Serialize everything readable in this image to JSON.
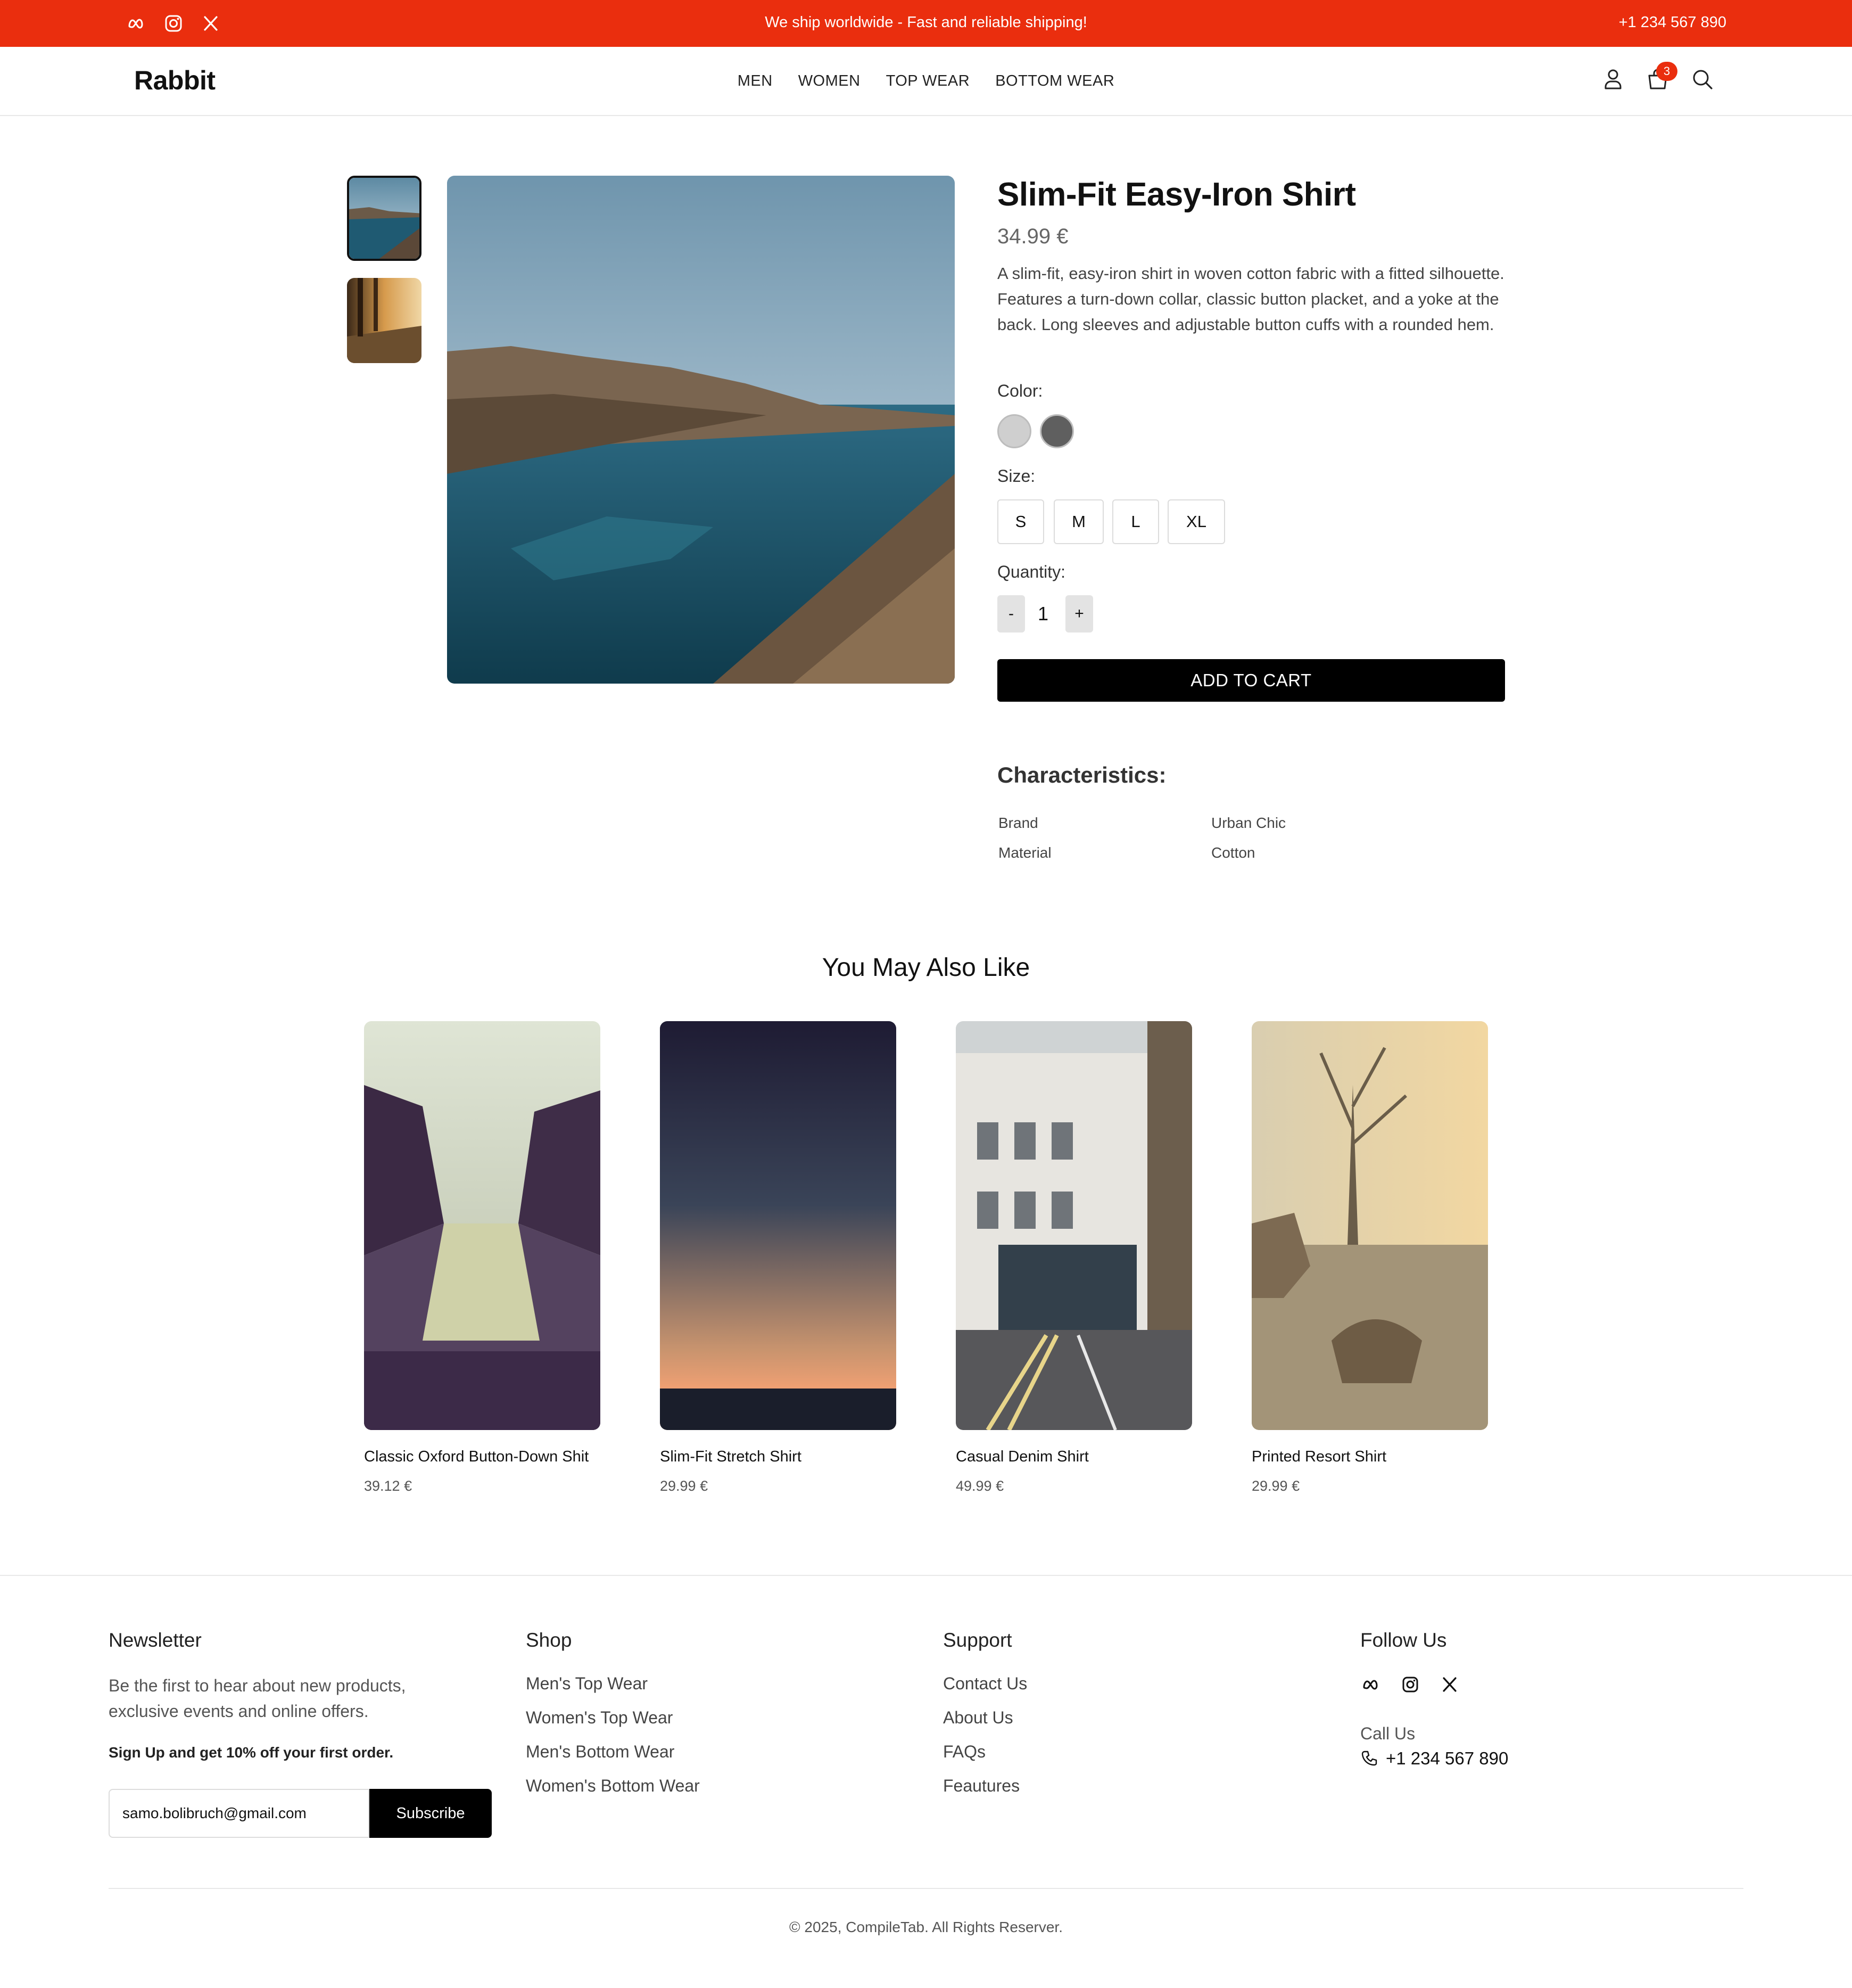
{
  "topbar": {
    "promo": "We ship worldwide - Fast and reliable shipping!",
    "phone": "+1 234 567 890",
    "icons": [
      "meta-icon",
      "instagram-icon",
      "x-icon"
    ]
  },
  "header": {
    "logo": "Rabbit",
    "nav": [
      "MEN",
      "WOMEN",
      "TOP WEAR",
      "BOTTOM WEAR"
    ],
    "cart_count": "3"
  },
  "product": {
    "title": "Slim-Fit Easy-Iron Shirt",
    "price": "34.99 €",
    "description": "A slim-fit, easy-iron shirt in woven cotton fabric with a fitted silhouette. Features a turn-down collar, classic button placket, and a yoke at the back. Long sleeves and adjustable button cuffs with a rounded hem.",
    "color_label": "Color:",
    "colors": [
      "#cfcfcf",
      "#5f5f5f"
    ],
    "size_label": "Size:",
    "sizes": [
      "S",
      "M",
      "L",
      "XL"
    ],
    "quantity_label": "Quantity:",
    "qty_minus": "-",
    "quantity": "1",
    "qty_plus": "+",
    "add_to_cart": "ADD TO CART"
  },
  "characteristics": {
    "title": "Characteristics:",
    "rows": [
      {
        "key": "Brand",
        "value": "Urban Chic"
      },
      {
        "key": "Material",
        "value": "Cotton"
      }
    ]
  },
  "related": {
    "title": "You May Also Like",
    "items": [
      {
        "name": "Classic Oxford Button-Down Shit",
        "price": "39.12 €"
      },
      {
        "name": "Slim-Fit Stretch Shirt",
        "price": "29.99 €"
      },
      {
        "name": "Casual Denim Shirt",
        "price": "49.99 €"
      },
      {
        "name": "Printed Resort Shirt",
        "price": "29.99 €"
      }
    ]
  },
  "footer": {
    "newsletter": {
      "title": "Newsletter",
      "text": "Be the first to hear about new products, exclusive events and online offers.",
      "bold": "Sign Up and get 10% off your first order.",
      "email_value": "samo.bolibruch@gmail.com",
      "subscribe": "Subscribe"
    },
    "shop": {
      "title": "Shop",
      "links": [
        "Men's Top Wear",
        "Women's Top Wear",
        "Men's Bottom Wear",
        "Women's Bottom Wear"
      ]
    },
    "support": {
      "title": "Support",
      "links": [
        "Contact Us",
        "About Us",
        "FAQs",
        "Feautures"
      ]
    },
    "follow": {
      "title": "Follow Us",
      "call_label": "Call Us",
      "phone": "+1 234 567 890"
    },
    "copyright": "© 2025, CompileTab. All Rights Reserver."
  },
  "colors": {
    "accent": "#ea2e0e",
    "button": "#000000"
  }
}
